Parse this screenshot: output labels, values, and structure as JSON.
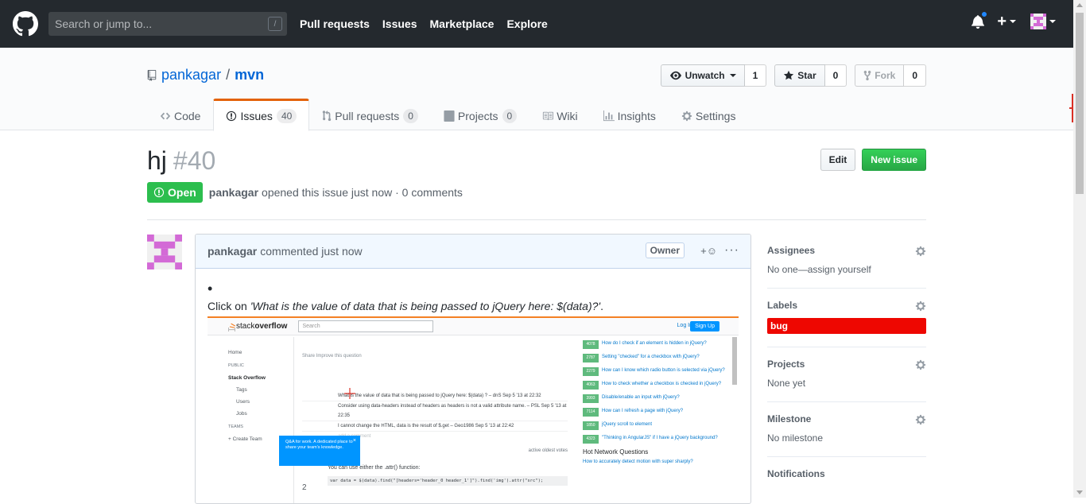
{
  "header": {
    "search_placeholder": "Search or jump to...",
    "search_shortcut": "/",
    "nav": [
      "Pull requests",
      "Issues",
      "Marketplace",
      "Explore"
    ],
    "plus": "+"
  },
  "repo": {
    "owner": "pankagar",
    "sep": "/",
    "name": "mvn",
    "unwatch_label": "Unwatch",
    "watch_count": "1",
    "star_label": "Star",
    "star_count": "0",
    "fork_label": "Fork",
    "fork_count": "0",
    "tabs": [
      {
        "label": "Code",
        "count": ""
      },
      {
        "label": "Issues",
        "count": "40"
      },
      {
        "label": "Pull requests",
        "count": "0"
      },
      {
        "label": "Projects",
        "count": "0"
      },
      {
        "label": "Wiki",
        "count": ""
      },
      {
        "label": "Insights",
        "count": ""
      },
      {
        "label": "Settings",
        "count": ""
      }
    ]
  },
  "issue": {
    "title": "hj",
    "number": "#40",
    "state": "Open",
    "author": "pankagar",
    "meta": "opened this issue just now · 0 comments",
    "edit_label": "Edit",
    "new_issue_label": "New issue"
  },
  "comment": {
    "author": "pankagar",
    "time": "commented just now",
    "owner_badge": "Owner",
    "react": "+☺",
    "more": "···",
    "bullet": "•",
    "text_prefix": "Click on ",
    "text_em": "'What is the value of data that is being passed to jQuery here: $(data)?'",
    "text_suffix": "."
  },
  "screenshot": {
    "logo_light": "stack",
    "logo_bold": "overflow",
    "search": "Search",
    "login": "Log In",
    "signup": "Sign Up",
    "left_nav": [
      "Home",
      "PUBLIC",
      "Stack Overflow",
      "Tags",
      "Users",
      "Jobs",
      "TEAMS",
      "+ Create Team"
    ],
    "main_lines": [
      "Share  Improve this question",
      "What is the value of  data  that is being passed to jQuery here: $(data) ? – dnS Sep 5 '13 at 22:32",
      "Consider using  data-headers  instead of  headers  as  headers  is not a valid attribute name. – PSL Sep 5 '13 at 22:35",
      "I cannot change the HTML, data is the result of $.get – Geo1986 Sep 5 '13 at 22:42",
      "add a comment",
      "active   oldest   votes",
      "You can use either the .attr() function:",
      "var data = $(data).find(\"[headers='header_0 header_1']\").find('img').attr(\"src\");"
    ],
    "vote_count": "2",
    "tip": "Q&A for work. A dedicated place to share your team's knowledge.",
    "tip_close": "×",
    "right_items": [
      {
        "score": "4078",
        "text": "How do I check if an element is hidden in jQuery?"
      },
      {
        "score": "2787",
        "text": "Setting \"checked\" for a checkbox with jQuery?"
      },
      {
        "score": "2279",
        "text": "How can I know which radio button is selected via jQuery?"
      },
      {
        "score": "4063",
        "text": "How to check whether a checkbox is checked in jQuery?"
      },
      {
        "score": "3993",
        "text": "Disable/enable an input with jQuery?"
      },
      {
        "score": "7114",
        "text": "How can I refresh a page with jQuery?"
      },
      {
        "score": "1850",
        "text": "jQuery scroll to element"
      },
      {
        "score": "4323",
        "text": "\"Thinking in AngularJS\" if I have a jQuery background?"
      }
    ],
    "hnq": "Hot Network Questions",
    "hnq_item": "How to accurately detect motion with super sharply?"
  },
  "sidebar": {
    "assignees_title": "Assignees",
    "assignees_value": "No one—assign yourself",
    "labels_title": "Labels",
    "label_bug": "bug",
    "projects_title": "Projects",
    "projects_value": "None yet",
    "milestone_title": "Milestone",
    "milestone_value": "No milestone",
    "notifications_title": "Notifications"
  },
  "colors": {
    "header_bg": "#24292e",
    "link": "#0366d6",
    "open_green": "#2cbe4e",
    "bug_label": "#ee0701",
    "tab_accent": "#e36209"
  }
}
